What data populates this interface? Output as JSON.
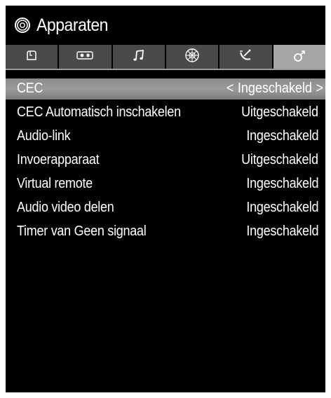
{
  "header": {
    "title": "Apparaten",
    "icon": "gear-ring-icon"
  },
  "tabs": [
    {
      "icon": "picture-icon",
      "active": false
    },
    {
      "icon": "sound-icon",
      "active": false
    },
    {
      "icon": "music-note-icon",
      "active": false
    },
    {
      "icon": "network-icon",
      "active": false
    },
    {
      "icon": "satellite-icon",
      "active": false
    },
    {
      "icon": "devices-icon",
      "active": true
    }
  ],
  "settings": [
    {
      "label": "CEC",
      "value": "Ingeschakeld",
      "selected": true,
      "arrow_left": "<",
      "arrow_right": ">"
    },
    {
      "label": "CEC Automatisch inschakelen",
      "value": "Uitgeschakeld",
      "selected": false
    },
    {
      "label": "Audio-link",
      "value": "Ingeschakeld",
      "selected": false
    },
    {
      "label": "Invoerapparaat",
      "value": "Uitgeschakeld",
      "selected": false
    },
    {
      "label": "Virtual remote",
      "value": "Ingeschakeld",
      "selected": false
    },
    {
      "label": "Audio video delen",
      "value": "Ingeschakeld",
      "selected": false
    },
    {
      "label": "Timer van Geen signaal",
      "value": "Ingeschakeld",
      "selected": false
    }
  ],
  "colors": {
    "background": "#000000",
    "tab_inactive": "#4a4a4a",
    "tab_active": "#a6a6a6",
    "selected_row": "#8e8e8e",
    "text": "#ffffff"
  }
}
